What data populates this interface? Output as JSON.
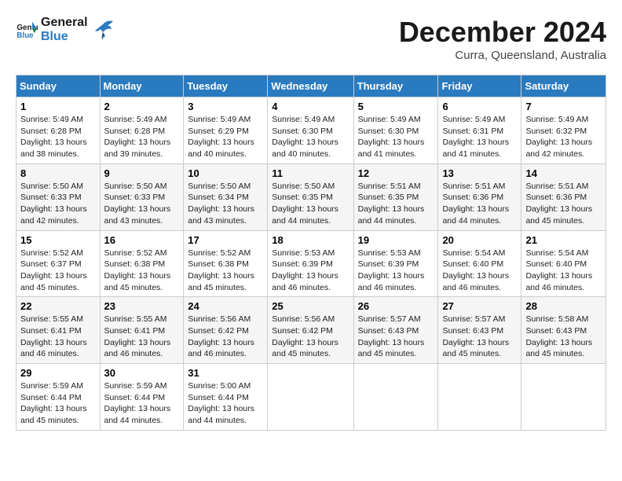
{
  "logo": {
    "line1": "General",
    "line2": "Blue"
  },
  "title": "December 2024",
  "location": "Curra, Queensland, Australia",
  "weekdays": [
    "Sunday",
    "Monday",
    "Tuesday",
    "Wednesday",
    "Thursday",
    "Friday",
    "Saturday"
  ],
  "weeks": [
    [
      {
        "day": "1",
        "sunrise": "5:49 AM",
        "sunset": "6:28 PM",
        "daylight": "13 hours and 38 minutes."
      },
      {
        "day": "2",
        "sunrise": "5:49 AM",
        "sunset": "6:28 PM",
        "daylight": "13 hours and 39 minutes."
      },
      {
        "day": "3",
        "sunrise": "5:49 AM",
        "sunset": "6:29 PM",
        "daylight": "13 hours and 40 minutes."
      },
      {
        "day": "4",
        "sunrise": "5:49 AM",
        "sunset": "6:30 PM",
        "daylight": "13 hours and 40 minutes."
      },
      {
        "day": "5",
        "sunrise": "5:49 AM",
        "sunset": "6:30 PM",
        "daylight": "13 hours and 41 minutes."
      },
      {
        "day": "6",
        "sunrise": "5:49 AM",
        "sunset": "6:31 PM",
        "daylight": "13 hours and 41 minutes."
      },
      {
        "day": "7",
        "sunrise": "5:49 AM",
        "sunset": "6:32 PM",
        "daylight": "13 hours and 42 minutes."
      }
    ],
    [
      {
        "day": "8",
        "sunrise": "5:50 AM",
        "sunset": "6:33 PM",
        "daylight": "13 hours and 42 minutes."
      },
      {
        "day": "9",
        "sunrise": "5:50 AM",
        "sunset": "6:33 PM",
        "daylight": "13 hours and 43 minutes."
      },
      {
        "day": "10",
        "sunrise": "5:50 AM",
        "sunset": "6:34 PM",
        "daylight": "13 hours and 43 minutes."
      },
      {
        "day": "11",
        "sunrise": "5:50 AM",
        "sunset": "6:35 PM",
        "daylight": "13 hours and 44 minutes."
      },
      {
        "day": "12",
        "sunrise": "5:51 AM",
        "sunset": "6:35 PM",
        "daylight": "13 hours and 44 minutes."
      },
      {
        "day": "13",
        "sunrise": "5:51 AM",
        "sunset": "6:36 PM",
        "daylight": "13 hours and 44 minutes."
      },
      {
        "day": "14",
        "sunrise": "5:51 AM",
        "sunset": "6:36 PM",
        "daylight": "13 hours and 45 minutes."
      }
    ],
    [
      {
        "day": "15",
        "sunrise": "5:52 AM",
        "sunset": "6:37 PM",
        "daylight": "13 hours and 45 minutes."
      },
      {
        "day": "16",
        "sunrise": "5:52 AM",
        "sunset": "6:38 PM",
        "daylight": "13 hours and 45 minutes."
      },
      {
        "day": "17",
        "sunrise": "5:52 AM",
        "sunset": "6:38 PM",
        "daylight": "13 hours and 45 minutes."
      },
      {
        "day": "18",
        "sunrise": "5:53 AM",
        "sunset": "6:39 PM",
        "daylight": "13 hours and 46 minutes."
      },
      {
        "day": "19",
        "sunrise": "5:53 AM",
        "sunset": "6:39 PM",
        "daylight": "13 hours and 46 minutes."
      },
      {
        "day": "20",
        "sunrise": "5:54 AM",
        "sunset": "6:40 PM",
        "daylight": "13 hours and 46 minutes."
      },
      {
        "day": "21",
        "sunrise": "5:54 AM",
        "sunset": "6:40 PM",
        "daylight": "13 hours and 46 minutes."
      }
    ],
    [
      {
        "day": "22",
        "sunrise": "5:55 AM",
        "sunset": "6:41 PM",
        "daylight": "13 hours and 46 minutes."
      },
      {
        "day": "23",
        "sunrise": "5:55 AM",
        "sunset": "6:41 PM",
        "daylight": "13 hours and 46 minutes."
      },
      {
        "day": "24",
        "sunrise": "5:56 AM",
        "sunset": "6:42 PM",
        "daylight": "13 hours and 46 minutes."
      },
      {
        "day": "25",
        "sunrise": "5:56 AM",
        "sunset": "6:42 PM",
        "daylight": "13 hours and 45 minutes."
      },
      {
        "day": "26",
        "sunrise": "5:57 AM",
        "sunset": "6:43 PM",
        "daylight": "13 hours and 45 minutes."
      },
      {
        "day": "27",
        "sunrise": "5:57 AM",
        "sunset": "6:43 PM",
        "daylight": "13 hours and 45 minutes."
      },
      {
        "day": "28",
        "sunrise": "5:58 AM",
        "sunset": "6:43 PM",
        "daylight": "13 hours and 45 minutes."
      }
    ],
    [
      {
        "day": "29",
        "sunrise": "5:59 AM",
        "sunset": "6:44 PM",
        "daylight": "13 hours and 45 minutes."
      },
      {
        "day": "30",
        "sunrise": "5:59 AM",
        "sunset": "6:44 PM",
        "daylight": "13 hours and 44 minutes."
      },
      {
        "day": "31",
        "sunrise": "5:00 AM",
        "sunset": "6:44 PM",
        "daylight": "13 hours and 44 minutes."
      },
      null,
      null,
      null,
      null
    ]
  ],
  "labels": {
    "sunrise": "Sunrise:",
    "sunset": "Sunset:",
    "daylight": "Daylight:"
  }
}
